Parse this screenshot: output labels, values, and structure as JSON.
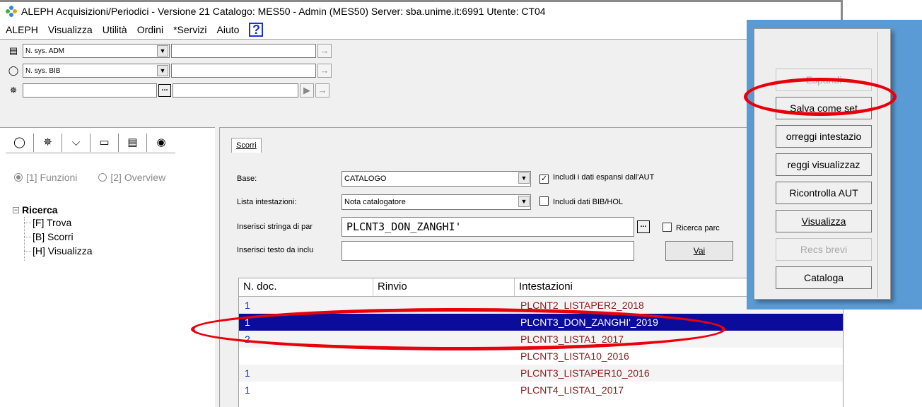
{
  "window": {
    "title": "ALEPH Acquisizioni/Periodici  - Versione 21  Catalogo: MES50 - Admin (MES50)  Server:  sba.unime.it:6991  Utente:  CT04"
  },
  "menu": [
    "ALEPH",
    "Visualizza",
    "Utilità",
    "Ordini",
    "*Servizi",
    "Aiuto"
  ],
  "quick": {
    "row1_combo": "N. sys. ADM",
    "row2_combo": "N. sys. BIB"
  },
  "left": {
    "radio1": "[1] Funzioni",
    "radio2": "[2] Overview",
    "tree_root": "Ricerca",
    "tree_items": [
      "[F] Trova",
      "[B] Scorri",
      "[H] Visualizza"
    ]
  },
  "browse": {
    "tab": "Scorri",
    "base_label": "Base:",
    "base_value": "CATALOGO",
    "headings_label": "Lista intestazioni:",
    "headings_value": "Nota catalogatore",
    "search_label": "Inserisci stringa di par",
    "search_value": "PLCNT3_DON_ZANGHI'",
    "text_label": "Inserisci testo da inclu",
    "check_expanded": "Includi i dati espansi dall'AUT",
    "check_bibhol": "Includi dati BIB/HOL",
    "check_partial": "Ricerca parc",
    "go_button": "Vai"
  },
  "list": {
    "headers": [
      "N. doc.",
      "Rinvio",
      "Intestazioni"
    ],
    "rows": [
      {
        "doc": "1",
        "ref": "",
        "heading": "PLCNT2_LISTAPER2_2018"
      },
      {
        "doc": "1",
        "ref": "",
        "heading": "PLCNT3_DON_ZANGHI'_2019"
      },
      {
        "doc": "2",
        "ref": "",
        "heading": "PLCNT3_LISTA1_2017"
      },
      {
        "doc": "",
        "ref": "",
        "heading": "PLCNT3_LISTA10_2016"
      },
      {
        "doc": "1",
        "ref": "",
        "heading": "PLCNT3_LISTAPER10_2016"
      },
      {
        "doc": "1",
        "ref": "",
        "heading": "PLCNT4_LISTA1_2017"
      }
    ],
    "selected_index": 1
  },
  "popup": {
    "buttons": [
      "Espandi",
      "Salva come set",
      "orreggi intestazio",
      "reggi visualizzaz",
      "Ricontrolla AUT",
      "Visualizza",
      "Recs brevi",
      "Cataloga"
    ]
  },
  "colors": {
    "selection": "#0c0c9c",
    "annotation": "#e8000a",
    "popup_background": "#5b9bd5"
  }
}
